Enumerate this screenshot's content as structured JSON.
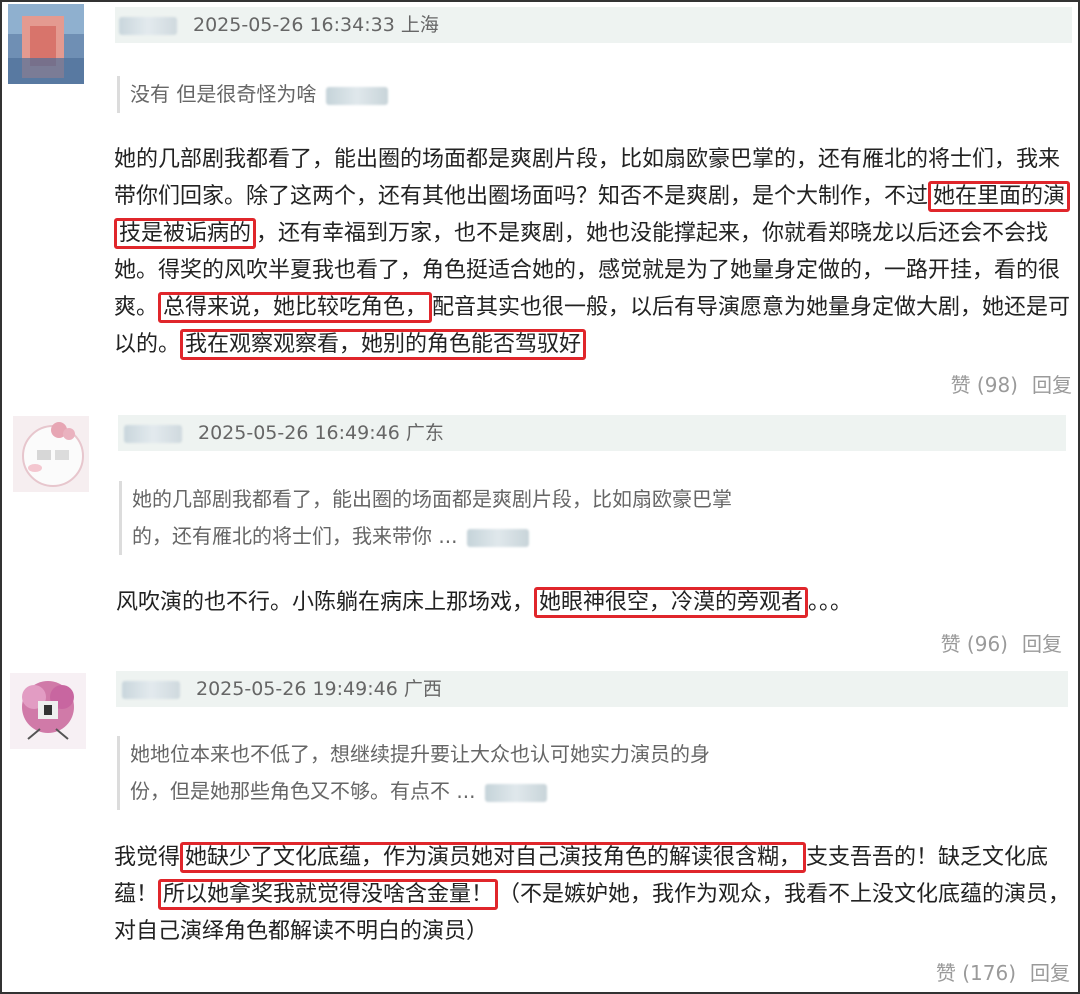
{
  "comments": [
    {
      "timestamp": "2025-05-26 16:34:33",
      "location": "上海",
      "quote": "没有 但是很奇怪为啥",
      "body_lines": [
        [
          "她的几部剧我都看了，能出圈的场面都是爽剧片段，比如扇欧豪巴掌的，还有雁北的将士们，我来"
        ],
        [
          "带你们回家。除了这两个，还有其他出圈场面吗？知否不是爽剧，是个大制作，不过",
          {
            "hl": "她在里面的演"
          }
        ],
        [
          {
            "hl": "技是被诟病的"
          },
          "，还有幸福到万家，也不是爽剧，她也没能撑起来，你就看郑晓龙以后还会不会找"
        ],
        [
          "她。得奖的风吹半夏我也看了，角色挺适合她的，感觉就是为了她量身定做的，一路开挂，看的很"
        ],
        [
          "爽。",
          {
            "hl": "总得来说，她比较吃角色，"
          },
          "配音其实也很一般，以后有导演愿意为她量身定做大剧，她还是可"
        ],
        [
          "以的。",
          {
            "hl": "我在观察观察看，她别的角色能否驾驭好"
          }
        ]
      ],
      "like_label": "赞 (98)",
      "reply_label": "回复"
    },
    {
      "timestamp": "2025-05-26 16:49:46",
      "location": "广东",
      "quote_lines": [
        "她的几部剧我都看了，能出圈的场面都是爽剧片段，比如扇欧豪巴掌",
        "的，还有雁北的将士们，我来带你 ..."
      ],
      "body_lines": [
        [
          "风吹演的也不行。小陈躺在病床上那场戏，",
          {
            "hl": "她眼神很空，冷漠的旁观者"
          },
          "。。。"
        ]
      ],
      "like_label": "赞 (96)",
      "reply_label": "回复"
    },
    {
      "timestamp": "2025-05-26 19:49:46",
      "location": "广西",
      "quote_lines": [
        "她地位本来也不低了，想继续提升要让大众也认可她实力演员的身",
        "份，但是她那些角色又不够。有点不 ..."
      ],
      "body_lines": [
        [
          "我觉得",
          {
            "hl": "她缺少了文化底蕴，作为演员她对自己演技角色的解读很含糊，"
          },
          "支支吾吾的！缺乏文化底"
        ],
        [
          "蕴！",
          {
            "hl": "所以她拿奖我就觉得没啥含金量！"
          },
          "（不是嫉妒她，我作为观众，我看不上没文化底蕴的演员，"
        ],
        [
          "对自己演绎角色都解读不明白的演员）"
        ]
      ],
      "like_label": "赞 (176)",
      "reply_label": "回复"
    }
  ]
}
